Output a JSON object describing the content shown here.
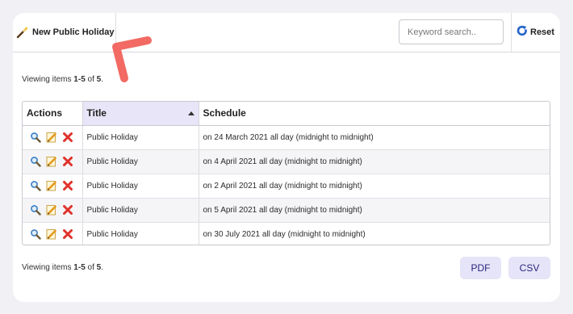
{
  "toolbar": {
    "new_label": "New Public Holiday",
    "search_placeholder": "Keyword search..",
    "reset_label": "Reset"
  },
  "summary": {
    "prefix": "Viewing items ",
    "range": "1-5",
    "of": " of ",
    "total": "5",
    "suffix": "."
  },
  "table": {
    "headers": [
      "Actions",
      "Title",
      "Schedule"
    ],
    "sorted_column": "Title",
    "rows": [
      {
        "title": "Public Holiday",
        "schedule": "on 24 March 2021 all day (midnight to midnight)"
      },
      {
        "title": "Public Holiday",
        "schedule": "on 4 April 2021 all day (midnight to midnight)"
      },
      {
        "title": "Public Holiday",
        "schedule": "on 2 April 2021 all day (midnight to midnight)"
      },
      {
        "title": "Public Holiday",
        "schedule": "on 5 April 2021 all day (midnight to midnight)"
      },
      {
        "title": "Public Holiday",
        "schedule": "on 30 July 2021 all day (midnight to midnight)"
      }
    ],
    "row_actions": [
      "view-icon",
      "edit-icon",
      "delete-icon"
    ]
  },
  "export": {
    "pdf_label": "PDF",
    "csv_label": "CSV"
  },
  "colors": {
    "accent_bg": "#e6e4f8",
    "accent_text": "#2d2580",
    "annotation_arrow": "#f26a63",
    "delete_red": "#e0322b",
    "reset_blue": "#2563c9"
  }
}
